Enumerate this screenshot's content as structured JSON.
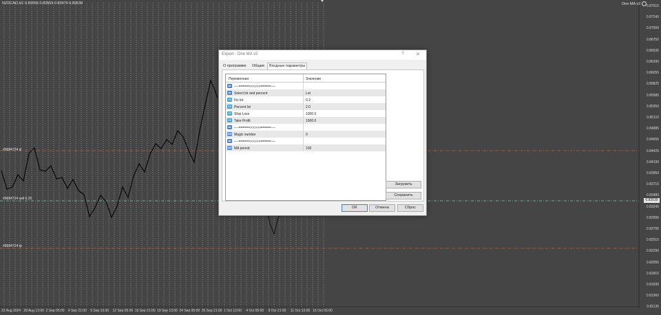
{
  "chart": {
    "title": "NZDCAD,H1  0.83555 0.83559 0.83479 0.83539",
    "indicator_label": "One MA v2",
    "price_axis": [
      "0.87515",
      "0.87240",
      "0.87000",
      "0.86750",
      "0.86535",
      "0.86290",
      "0.86055",
      "0.85825",
      "0.85585",
      "0.85350",
      "0.85110",
      "0.84885",
      "0.84655",
      "0.84425",
      "0.84190",
      "0.83950",
      "0.83715",
      "0.83480",
      "0.83245",
      "0.82995",
      "0.82765",
      "0.82515",
      "0.82290",
      "0.82055",
      "0.81815",
      "0.81590",
      "0.81360",
      "0.81135"
    ],
    "current_price": "0.83539",
    "time_axis": [
      "22 Aug 2024",
      "28 Aug 13:00",
      "2 Sep 05:00",
      "4 Sep 21:00",
      "9 Sep 13:00",
      "12 Sep 05:00",
      "16 Sep 21:00",
      "19 Sep 13:00",
      "24 Sep 05:00",
      "26 Sep 21:00",
      "1 Oct 13:00",
      "4 Oct 05:00",
      "8 Oct 21:00",
      "11 Oct 13:00",
      "16 Oct 05:00"
    ],
    "levels": {
      "sl": "#9684724 sl",
      "entry": "#9684724 sell 0.20",
      "tp": "#9684724 tp"
    }
  },
  "dialog": {
    "title": "Expert - One MA v2",
    "help_glyph": "?",
    "close_glyph": "✕",
    "tabs": [
      "О программе",
      "Общие",
      "Входные параметры"
    ],
    "active_tab": 2,
    "grid": {
      "col_variable": "Переменная",
      "col_value": "Значение",
      "rows": [
        {
          "icon": "ab",
          "name": "----=====<<<>>>=====----",
          "value": ""
        },
        {
          "icon": "ab",
          "name": "Select lot and percent",
          "value": "Lot"
        },
        {
          "icon": "v2",
          "name": "Fix lot",
          "value": "0.2"
        },
        {
          "icon": "v2",
          "name": "Percent lot",
          "value": "2.0"
        },
        {
          "icon": "v2",
          "name": "Stop Loss",
          "value": "1000.0"
        },
        {
          "icon": "v2",
          "name": "Take Profit",
          "value": "1000.0"
        },
        {
          "icon": "ab",
          "name": "----=====<<<>>>=====----",
          "value": ""
        },
        {
          "icon": "v1",
          "name": "Magic number",
          "value": "0"
        },
        {
          "icon": "ab",
          "name": "----=====<<<>>>=====----",
          "value": ""
        },
        {
          "icon": "v1",
          "name": "MA period",
          "value": "100"
        }
      ]
    },
    "icon_text": {
      "ab": "ab",
      "v2": "V2",
      "v1": "123"
    },
    "buttons": {
      "load": "Загрузить",
      "save": "Сохранить",
      "ok": "OK",
      "cancel": "Отмена",
      "reset": "Сброс"
    }
  },
  "colors": {
    "chart_bg": "#454545",
    "candles": "#000000",
    "sl_line": "#c8643c",
    "entry_line": "#7fd0a8",
    "tp_line": "#c8643c",
    "grid_dots": "#cfcfcf"
  }
}
